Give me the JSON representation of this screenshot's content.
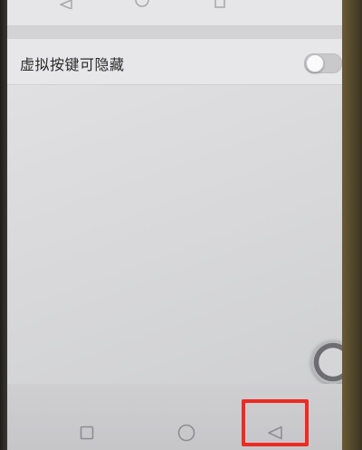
{
  "setting": {
    "label": "虚拟按键可隐藏",
    "enabled": false
  },
  "navigation": {
    "top": [
      "back-triangle-icon",
      "home-circle-icon",
      "recent-square-icon"
    ],
    "bottom": [
      "recent-square-icon",
      "home-circle-icon",
      "back-triangle-icon"
    ]
  },
  "colors": {
    "highlight": "#ee2a22",
    "screen": "#dcdcde"
  }
}
